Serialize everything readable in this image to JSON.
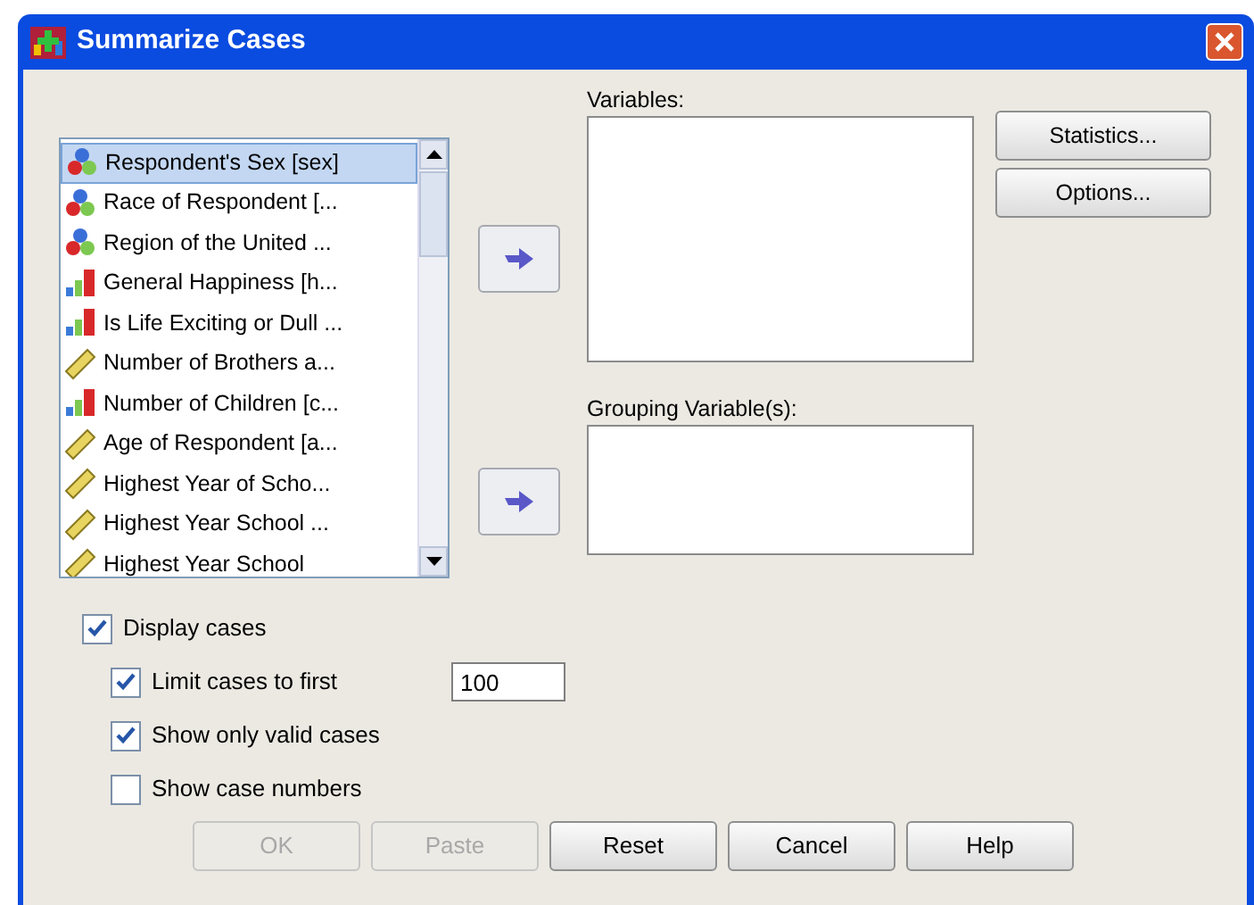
{
  "window": {
    "title": "Summarize Cases"
  },
  "source_list": {
    "items": [
      {
        "label": "Respondent's Sex [sex]",
        "kind": "nominal",
        "selected": true
      },
      {
        "label": "Race of Respondent [...",
        "kind": "nominal",
        "selected": false
      },
      {
        "label": "Region of the United ...",
        "kind": "nominal",
        "selected": false
      },
      {
        "label": "General Happiness [h...",
        "kind": "ordinal",
        "selected": false
      },
      {
        "label": "Is Life Exciting or Dull ...",
        "kind": "ordinal",
        "selected": false
      },
      {
        "label": "Number of Brothers a...",
        "kind": "scale",
        "selected": false
      },
      {
        "label": "Number of Children [c...",
        "kind": "ordinal",
        "selected": false
      },
      {
        "label": "Age of Respondent [a...",
        "kind": "scale",
        "selected": false
      },
      {
        "label": "Highest Year of Scho...",
        "kind": "scale",
        "selected": false
      },
      {
        "label": "Highest Year School ...",
        "kind": "scale",
        "selected": false
      },
      {
        "label": "Highest Year School",
        "kind": "scale",
        "selected": false
      }
    ]
  },
  "variables": {
    "label": "Variables:"
  },
  "grouping": {
    "label": "Grouping Variable(s):"
  },
  "side_buttons": [
    "Statistics...",
    "Options..."
  ],
  "options": [
    {
      "label": "Display cases",
      "checked": true,
      "indented": false
    },
    {
      "label": "Limit cases to first",
      "checked": true,
      "indented": true,
      "value": "100"
    },
    {
      "label": "Show only valid cases",
      "checked": true,
      "indented": true
    },
    {
      "label": "Show case numbers",
      "checked": false,
      "indented": true
    }
  ],
  "buttons": [
    {
      "label": "OK",
      "disabled": true
    },
    {
      "label": "Paste",
      "disabled": true
    },
    {
      "label": "Reset",
      "disabled": false
    },
    {
      "label": "Cancel",
      "disabled": false
    },
    {
      "label": "Help",
      "disabled": false
    }
  ]
}
